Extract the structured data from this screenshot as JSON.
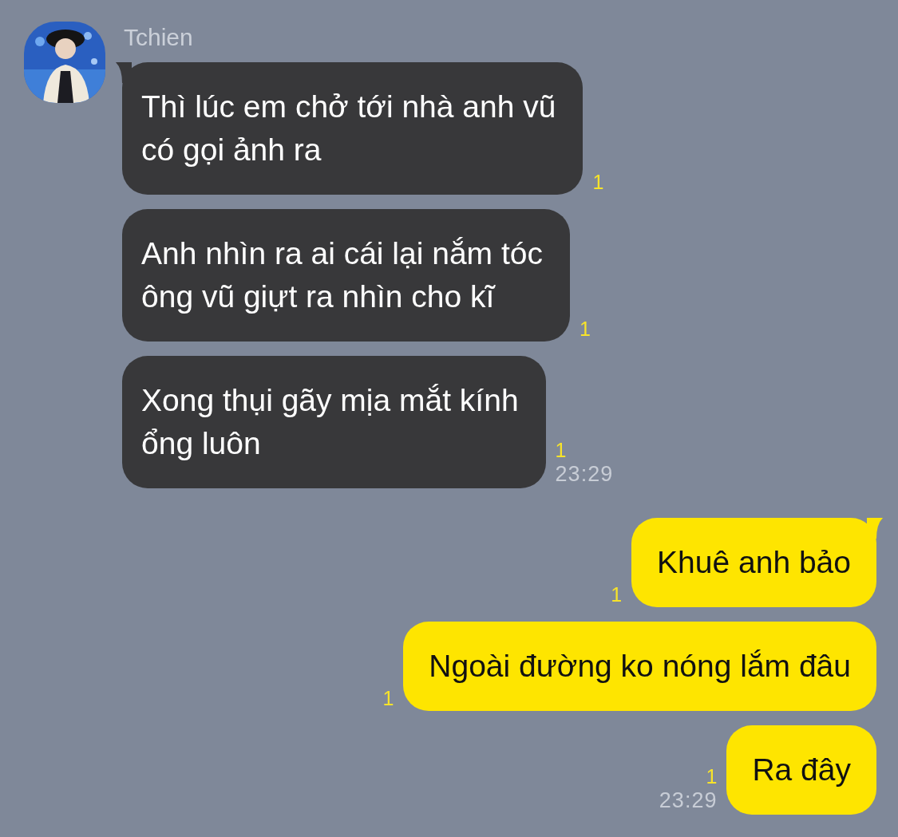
{
  "groups": [
    {
      "kind": "received",
      "sender": "Tchien",
      "time": "23:29",
      "messages": [
        {
          "text": "Thì lúc em chở tới nhà anh vũ\ncó gọi ảnh ra",
          "unread": "1"
        },
        {
          "text": "Anh nhìn ra ai cái lại nắm tóc\nông vũ giựt ra nhìn cho kĩ",
          "unread": "1"
        },
        {
          "text": "Xong thụi gãy mịa mắt kính\nổng luôn",
          "unread": "1"
        }
      ]
    },
    {
      "kind": "sent",
      "time": "23:29",
      "messages": [
        {
          "text": "Khuê anh bảo",
          "unread": "1"
        },
        {
          "text": "Ngoài đường ko nóng lắm đâu",
          "unread": "1"
        },
        {
          "text": "Ra đây",
          "unread": "1"
        }
      ]
    }
  ]
}
